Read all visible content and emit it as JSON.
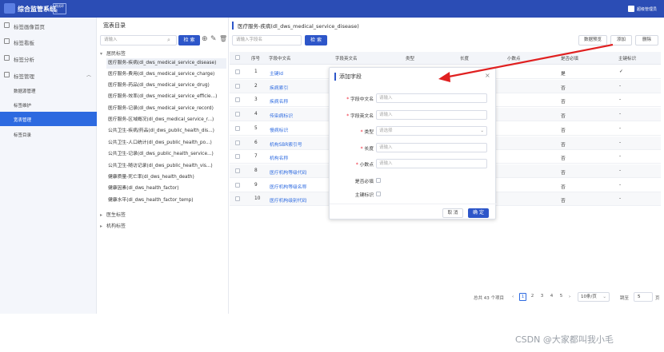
{
  "app": {
    "title": "综合监管系统",
    "badge": "测试环境",
    "user": "超级管理员"
  },
  "sidebar": {
    "items": [
      {
        "label": "标签画像首页"
      },
      {
        "label": "标签看板"
      },
      {
        "label": "标签分析"
      },
      {
        "label": "标签管理"
      }
    ],
    "subitems": [
      {
        "label": "数据源管理"
      },
      {
        "label": "标签维护"
      },
      {
        "label": "宽表管理"
      },
      {
        "label": "标签目录"
      }
    ]
  },
  "catalog": {
    "title": "宽表目录",
    "search_placeholder": "请输入",
    "search_button": "检 索",
    "root": "居民标签",
    "leaves": [
      "医疗服务-疾病(dl_dws_medical_service_disease)",
      "医疗服务-费用(dl_dws_medical_service_charge)",
      "医疗服务-药品(dl_dws_medical_service_drug)",
      "医疗服务-效率(dl_dws_medical_service_efficie...)",
      "医疗服务-记录(dl_dws_medical_service_record)",
      "医疗服务-区域概况(dl_dws_medical_service_r...)",
      "公共卫生-疾病/药品(dl_dws_public_health_dis...)",
      "公共卫生-人口统计(dl_dws_public_health_po...)",
      "公共卫生-记录(dl_dws_public_health_service...)",
      "公共卫生-随访记录(dl_dws_public_health_vis...)",
      "健康质量-死亡率(dl_dws_health_death)",
      "健康因素(dl_dws_health_factor)",
      "健康水平(dl_dws_health_factor_temp)"
    ],
    "others": [
      "医生标签",
      "机构标签"
    ]
  },
  "main": {
    "path_title": "医疗服务-疾病(dl_dws_medical_service_disease)",
    "search_placeholder": "请输入字段名",
    "search_button": "检 索",
    "actions": {
      "preview": "数据预览",
      "add": "添加",
      "delete": "删除"
    },
    "columns": [
      "序号",
      "字段中文名",
      "字段英文名",
      "类型",
      "长度",
      "小数点",
      "是否必填",
      "主键标识"
    ],
    "rows": [
      {
        "no": "1",
        "cn": "主键id",
        "req": "是",
        "pk": "✓"
      },
      {
        "no": "2",
        "cn": "疾病索引",
        "req": "否",
        "pk": "-"
      },
      {
        "no": "3",
        "cn": "疾病名称",
        "req": "否",
        "pk": "-"
      },
      {
        "no": "4",
        "cn": "传染病标识",
        "req": "否",
        "pk": "-"
      },
      {
        "no": "5",
        "cn": "慢病标识",
        "req": "否",
        "pk": "-"
      },
      {
        "no": "6",
        "cn": "机构SBR索引号",
        "req": "否",
        "pk": "-"
      },
      {
        "no": "7",
        "cn": "机构名称",
        "req": "否",
        "pk": "-"
      },
      {
        "no": "8",
        "cn": "医疗机构等级代码",
        "req": "否",
        "pk": "-"
      },
      {
        "no": "9",
        "cn": "医疗机构等级名称",
        "req": "否",
        "pk": "-"
      },
      {
        "no": "10",
        "cn": "医疗机构级别代码",
        "req": "否",
        "pk": "-"
      }
    ],
    "pagination": {
      "total": "总共 43 个项目",
      "pages": [
        "1",
        "2",
        "3",
        "4",
        "5"
      ],
      "page_size": "10条/页",
      "jump_label": "跳至",
      "jump_value": "5",
      "page_suffix": "页"
    }
  },
  "modal": {
    "title": "添加字段",
    "fields": [
      {
        "label": "字段中文名",
        "placeholder": "请输入",
        "required": true
      },
      {
        "label": "字段英文名",
        "placeholder": "请输入",
        "required": true
      },
      {
        "label": "类型",
        "placeholder": "请选择",
        "required": true
      },
      {
        "label": "长度",
        "placeholder": "请输入",
        "required": true
      },
      {
        "label": "小数点",
        "placeholder": "请输入",
        "required": true
      }
    ],
    "checkboxes": [
      "是否必填",
      "主键标识"
    ],
    "cancel": "取 消",
    "confirm": "确 定"
  },
  "watermark": "CSDN @大家都叫我小毛",
  "colors": {
    "accent": "#2d56c9",
    "topbar": "#2b4db5",
    "link": "#2d6ae0",
    "arrow": "#e02020"
  }
}
